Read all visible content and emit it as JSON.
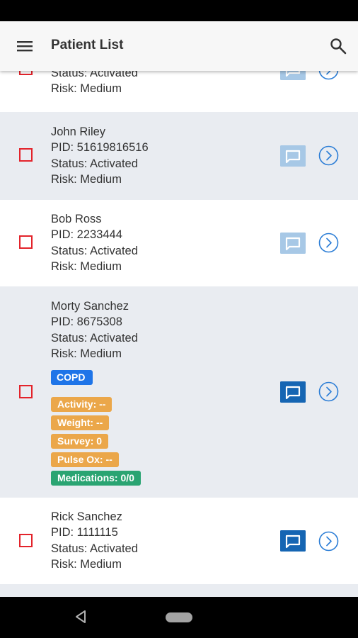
{
  "app_bar": {
    "title": "Patient List",
    "menu_icon": "hamburger-menu-icon",
    "search_icon": "search-icon"
  },
  "colors": {
    "checkbox": "#e3232b",
    "chevron": "#2b7dd6",
    "message_light": "#a7c8e6",
    "message_dark": "#1565b3",
    "badge_blue": "#1e74e8",
    "badge_orange": "#eba74a",
    "badge_green": "#2aa472"
  },
  "patients": [
    {
      "name": "",
      "pid": "",
      "status": "Status: Activated",
      "risk": "Risk: Medium"
    },
    {
      "name": "John Riley",
      "pid": "PID: 51619816516",
      "status": "Status: Activated",
      "risk": "Risk: Medium"
    },
    {
      "name": "Bob Ross",
      "pid": "PID: 2233444",
      "status": "Status: Activated",
      "risk": "Risk: Medium"
    },
    {
      "name": "Morty Sanchez",
      "pid": "PID: 8675308",
      "status": "Status: Activated",
      "risk": "Risk: Medium",
      "tag": "COPD",
      "metrics": {
        "activity": "Activity: --",
        "weight": "Weight: --",
        "survey": "Survey: 0",
        "pulse_ox": "Pulse Ox: --",
        "medications": "Medications: 0/0"
      }
    },
    {
      "name": "Rick Sanchez",
      "pid": "PID: 1111115",
      "status": "Status: Activated",
      "risk": "Risk: Medium"
    }
  ],
  "system_nav": {
    "back_icon": "back-triangle-icon",
    "home_icon": "home-pill-icon"
  }
}
